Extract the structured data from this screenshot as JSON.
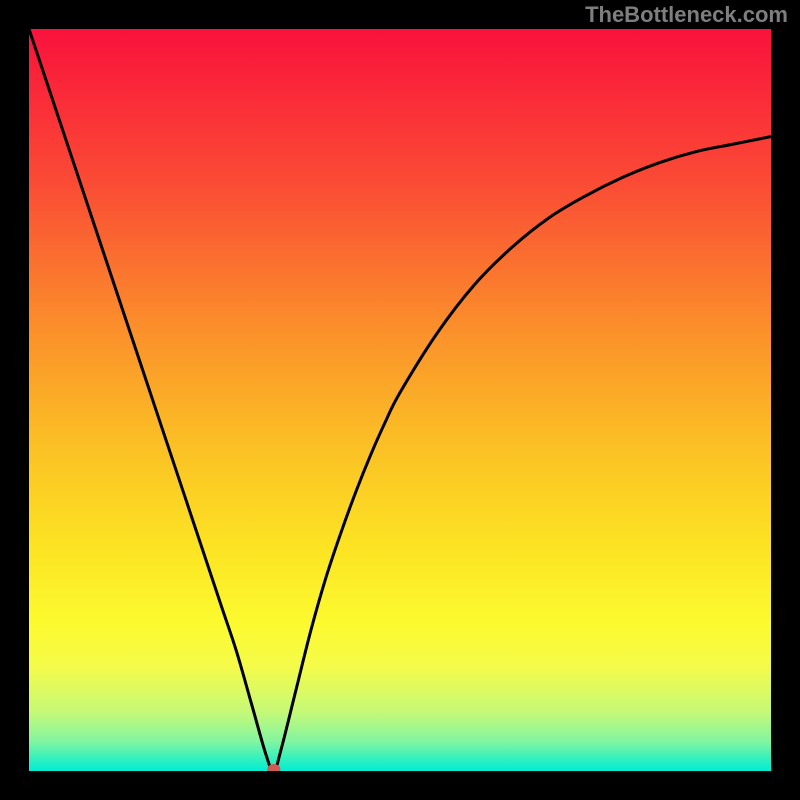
{
  "attribution": "TheBottleneck.com",
  "chart_data": {
    "type": "line",
    "title": "",
    "xlabel": "",
    "ylabel": "",
    "xlim": [
      0,
      100
    ],
    "ylim": [
      0,
      100
    ],
    "x": [
      0,
      2,
      4,
      6,
      8,
      10,
      12,
      14,
      16,
      18,
      20,
      22,
      24,
      26,
      28,
      30,
      32,
      33,
      34,
      36,
      38,
      40,
      42,
      44,
      46,
      48,
      50,
      55,
      60,
      65,
      70,
      75,
      80,
      85,
      90,
      95,
      100
    ],
    "values": [
      100,
      94,
      88,
      82,
      76,
      70,
      64,
      58,
      52,
      46,
      40,
      34,
      28,
      22,
      16,
      9,
      2,
      0,
      3,
      11,
      19,
      26,
      32,
      37.5,
      42.5,
      47,
      51,
      59,
      65.5,
      70.5,
      74.5,
      77.5,
      80,
      82,
      83.5,
      84.5,
      85.5
    ],
    "marker": {
      "x": 33,
      "y": 0,
      "color": "#d15a52"
    },
    "line_color": "#000000",
    "background": {
      "type": "vertical-gradient",
      "stops": [
        {
          "pos": 0.0,
          "color": "#f9123c"
        },
        {
          "pos": 0.2,
          "color": "#fa4935"
        },
        {
          "pos": 0.4,
          "color": "#fb8e2b"
        },
        {
          "pos": 0.55,
          "color": "#fbbd25"
        },
        {
          "pos": 0.7,
          "color": "#fce423"
        },
        {
          "pos": 0.8,
          "color": "#fcfa2f"
        },
        {
          "pos": 0.86,
          "color": "#f4fb4a"
        },
        {
          "pos": 0.92,
          "color": "#c6f977"
        },
        {
          "pos": 0.96,
          "color": "#83f5a0"
        },
        {
          "pos": 0.985,
          "color": "#2ef0c1"
        },
        {
          "pos": 1.0,
          "color": "#01eed4"
        }
      ]
    }
  }
}
